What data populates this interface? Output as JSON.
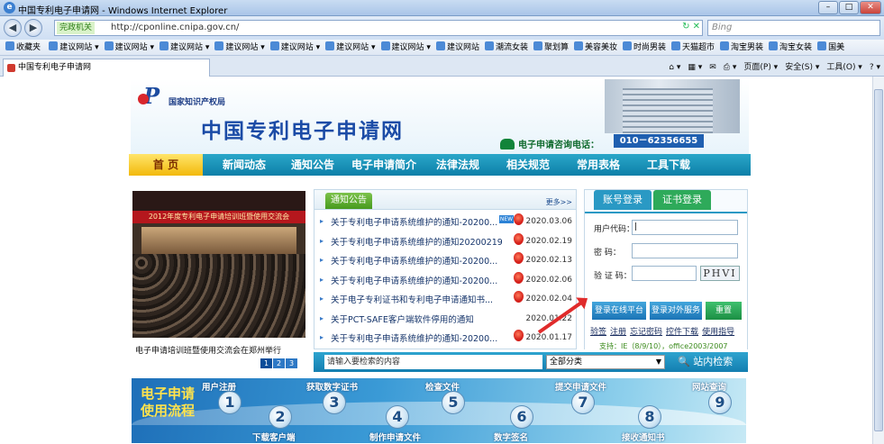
{
  "window": {
    "title": "中国专利电子申请网 - Windows Internet Explorer",
    "minimize": "–",
    "maximize": "□",
    "close": "✕"
  },
  "addressbar": {
    "back": "◀",
    "forward": "▶",
    "compat_badge": "完政机关",
    "url": "http://cponline.cnipa.gov.cn/",
    "tools": "↻ ✕",
    "search_placeholder": "Bing"
  },
  "favorites": {
    "label": "收藏夹",
    "items": [
      "建议网站 ▾",
      "建议网站 ▾",
      "建议网站 ▾",
      "建议网站 ▾",
      "建议网站 ▾",
      "建议网站 ▾",
      "建议网站 ▾",
      "建议网站",
      "潮流女装",
      "聚划算",
      "美容美妆",
      "时尚男装",
      "天猫超市",
      "淘宝男装",
      "淘宝女装",
      "国美"
    ]
  },
  "tab": {
    "label": "中国专利电子申请网",
    "tools": [
      "⌂ ▾",
      "▦ ▾",
      "✉",
      "⎙ ▾",
      "页面(P) ▾",
      "安全(S) ▾",
      "工具(O) ▾",
      "? ▾"
    ]
  },
  "header": {
    "org": "国家知识产权局",
    "site_name": "中国专利电子申请网",
    "hotline_label": "电子申请咨询电话：",
    "phone": "010－62356655"
  },
  "nav": [
    "首 页",
    "新闻动态",
    "通知公告",
    "电子申请简介",
    "法律法规",
    "相关规范",
    "常用表格",
    "工具下载"
  ],
  "photo": {
    "banner": "2012年度专利电子申请培训班暨使用交流会",
    "caption": "电子申请培训班暨使用交流会在郑州举行",
    "pages": [
      "1",
      "2",
      "3"
    ]
  },
  "notices": {
    "label": "通知公告",
    "more": "更多>>",
    "items": [
      {
        "title": "关于专利电子申请系统维护的通知-20200...",
        "date": "2020.03.06",
        "new": "NEW"
      },
      {
        "title": "关于专利电子申请系统维护的通知20200219",
        "date": "2020.02.19"
      },
      {
        "title": "关于专利电子申请系统维护的通知-20200...",
        "date": "2020.02.13"
      },
      {
        "title": "关于专利电子申请系统维护的通知-20200...",
        "date": "2020.02.06"
      },
      {
        "title": "关于电子专利证书和专利电子申请通知书...",
        "date": "2020.02.04"
      },
      {
        "title": "关于PCT-SAFE客户端软件停用的通知",
        "date": "2020.01.22"
      },
      {
        "title": "关于专利电子申请系统维护的通知-20200...",
        "date": "2020.01.17"
      }
    ]
  },
  "login": {
    "tab_account": "账号登录",
    "tab_cert": "证书登录",
    "user_label": "用户代码：",
    "pwd_label": "密    码：",
    "code_label": "验 证 码：",
    "captcha": "PHVI",
    "btn_online": "登录在线平台",
    "btn_service": "登录对外服务",
    "btn_reset": "重置",
    "links": [
      "验签",
      "注册",
      "忘记密码",
      "控件下载",
      "使用指导"
    ],
    "support": "支持：IE（8/9/10），office2003/2007"
  },
  "searchbar": {
    "input": "请输入要检索的内容",
    "category": "全部分类",
    "button": "站内检索"
  },
  "flow": {
    "title_line1": "电子申请",
    "title_line2": "使用流程",
    "steps": [
      {
        "n": "1",
        "label": "用户注册"
      },
      {
        "n": "2",
        "label": "下载客户端"
      },
      {
        "n": "3",
        "label": "获取数字证书"
      },
      {
        "n": "4",
        "label": "制作申请文件"
      },
      {
        "n": "5",
        "label": "检查文件"
      },
      {
        "n": "6",
        "label": "数字签名"
      },
      {
        "n": "7",
        "label": "提交申请文件"
      },
      {
        "n": "8",
        "label": "接收通知书"
      },
      {
        "n": "9",
        "label": "网站查询"
      }
    ]
  },
  "colors": {
    "nav_bg": "#137eb0",
    "nav_active": "#f2b90b",
    "brand_blue": "#1b4ba6",
    "alert_red": "#e02b2b"
  }
}
